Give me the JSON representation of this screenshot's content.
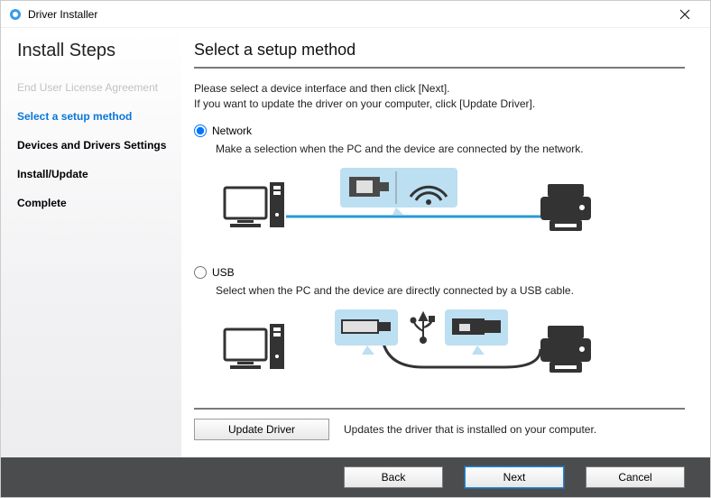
{
  "window": {
    "title": "Driver Installer"
  },
  "sidebar": {
    "heading": "Install Steps",
    "steps": [
      {
        "label": "End User License Agreement",
        "state": "disabled"
      },
      {
        "label": "Select a setup method",
        "state": "active"
      },
      {
        "label": "Devices and Drivers Settings",
        "state": "future"
      },
      {
        "label": "Install/Update",
        "state": "future"
      },
      {
        "label": "Complete",
        "state": "future"
      }
    ]
  },
  "main": {
    "heading": "Select a setup method",
    "instruction_line1": "Please select a device interface and then click [Next].",
    "instruction_line2": "If you want to update the driver on your computer, click [Update Driver].",
    "options": {
      "network": {
        "label": "Network",
        "selected": true,
        "desc": "Make a selection when the PC and the device are connected by the network."
      },
      "usb": {
        "label": "USB",
        "selected": false,
        "desc": "Select when the PC and the device are directly connected by a USB cable."
      }
    },
    "update": {
      "button": "Update Driver",
      "desc": "Updates the driver that is installed on your computer."
    }
  },
  "footer": {
    "back": "Back",
    "next": "Next",
    "cancel": "Cancel"
  }
}
